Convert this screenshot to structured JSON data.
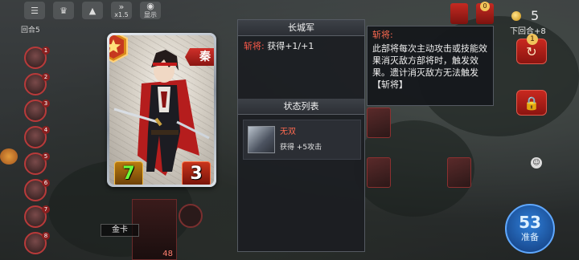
{
  "hud": {
    "round_label": "回合5",
    "top_icons": [
      {
        "name": "menu-icon",
        "glyph": "☰",
        "label": ""
      },
      {
        "name": "trophy-icon",
        "glyph": "♛",
        "label": ""
      },
      {
        "name": "like-icon",
        "glyph": "👍",
        "label": ""
      },
      {
        "name": "speed-icon",
        "glyph": "▶▶",
        "label": "x1.5"
      },
      {
        "name": "eye-icon",
        "glyph": "◉",
        "label": "显示"
      }
    ],
    "coin_count": "5",
    "next_round": "下回合+8",
    "refresh_badge": "1",
    "ready_number": "53",
    "ready_label": "准备",
    "top_badge": "0"
  },
  "avatars": [
    "1",
    "2",
    "3",
    "4",
    "5",
    "6",
    "7",
    "8"
  ],
  "board": {
    "gold_label": "金卡",
    "bottom_card_value": "48"
  },
  "hero_card": {
    "faction": "秦",
    "attack": "7",
    "health": "3",
    "colors": {
      "attack": "#6bff3a",
      "faction": "#c8281f"
    }
  },
  "panel": {
    "title": "长城军",
    "skill_name": "斩将:",
    "skill_effect": "获得+1/+1",
    "status_title": "状态列表",
    "status": {
      "name": "无双",
      "desc": "获得 +5攻击"
    }
  },
  "tooltip": {
    "title": "斩将:",
    "body": "此部将每次主动攻击或技能效果消灭敌方部将时，触发效果。遗计消灭敌方无法触发【斩将】"
  }
}
